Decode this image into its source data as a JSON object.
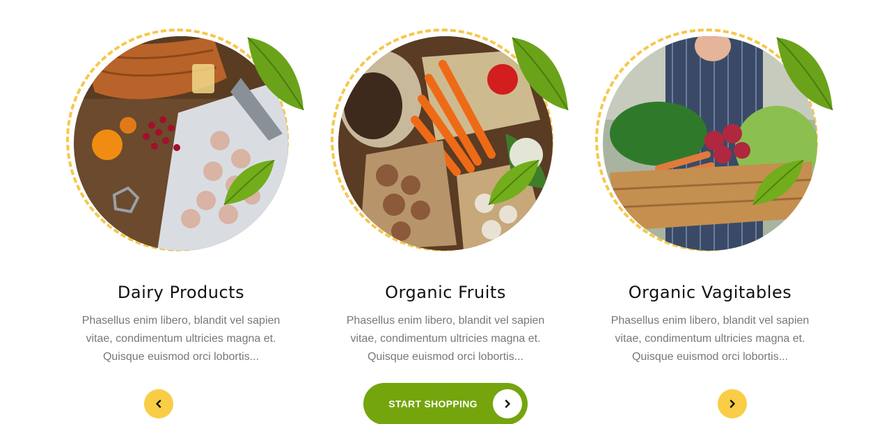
{
  "colors": {
    "accent_yellow": "#f9cd45",
    "dash_yellow": "#f6c84a",
    "brand_green": "#74a50d",
    "title": "#111111",
    "text": "#777777"
  },
  "categories": [
    {
      "title": "Dairy Products",
      "description": "Phasellus enim libero, blandit vel sapien vitae, condimentum ultricies magna et. Quisque euismod orci lobortis..."
    },
    {
      "title": "Organic Fruits",
      "description": "Phasellus enim libero, blandit vel sapien vitae, condimentum ultricies magna et. Quisque euismod orci lobortis..."
    },
    {
      "title": "Organic Vagitables",
      "description": "Phasellus enim libero, blandit vel sapien vitae, condimentum ultricies magna et. Quisque euismod orci lobortis..."
    }
  ],
  "cta": {
    "label": "START SHOPPING",
    "icon": "chevron-right-icon"
  },
  "carousel": {
    "prev_icon": "chevron-left-icon",
    "next_icon": "chevron-right-icon"
  }
}
